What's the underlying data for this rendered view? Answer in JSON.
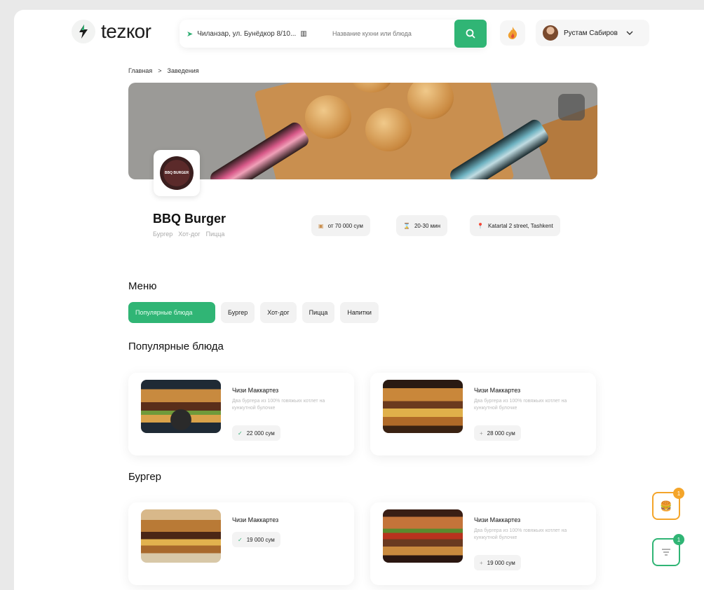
{
  "header": {
    "logo_text": "tezкor",
    "address": "Чиланзар, ул. Бунёдкор 8/10...",
    "search_placeholder": "Название кухни или блюда",
    "user_name": "Рустам Сабиров"
  },
  "breadcrumb": {
    "home": "Главная",
    "separator": ">",
    "current": "Заведения"
  },
  "restaurant": {
    "name": "BBQ Burger",
    "logo_text": "BBQ BURGER",
    "tags": [
      "Бургер",
      "Хот-дог",
      "Пицца"
    ],
    "info": {
      "min_order": "от 70 000 сум",
      "delivery_time": "20-30 мин",
      "address": "Katartal 2 street, Tashkent"
    }
  },
  "menu": {
    "title": "Меню",
    "tabs": [
      "Популярные блюда",
      "Бургер",
      "Хот-дог",
      "Пицца",
      "Напитки"
    ],
    "active_tab": 0
  },
  "sections": [
    {
      "title": "Популярные блюда",
      "items": [
        {
          "name": "Чизи Маккартез",
          "desc": "Два бургера из 100% говяжьих котлет на кунжутной булочке",
          "price": "22 000 сум",
          "added": true
        },
        {
          "name": "Чизи Маккартез",
          "desc": "Два бургера из 100% говяжьих котлет на кунжутной булочке",
          "price": "28 000 сум",
          "added": false
        }
      ]
    },
    {
      "title": "Бургер",
      "items": [
        {
          "name": "Чизи Маккартез",
          "desc": "",
          "price": "19 000 сум",
          "added": true
        },
        {
          "name": "Чизи Маккартез",
          "desc": "Два бургера из 100% говяжьих котлет на кунжутной булочке",
          "price": "19 000 сум",
          "added": false
        }
      ]
    }
  ],
  "floating": {
    "cart_badge": "1",
    "filter_badge": "1"
  },
  "colors": {
    "accent": "#30b575",
    "orange": "#f4a52a"
  }
}
